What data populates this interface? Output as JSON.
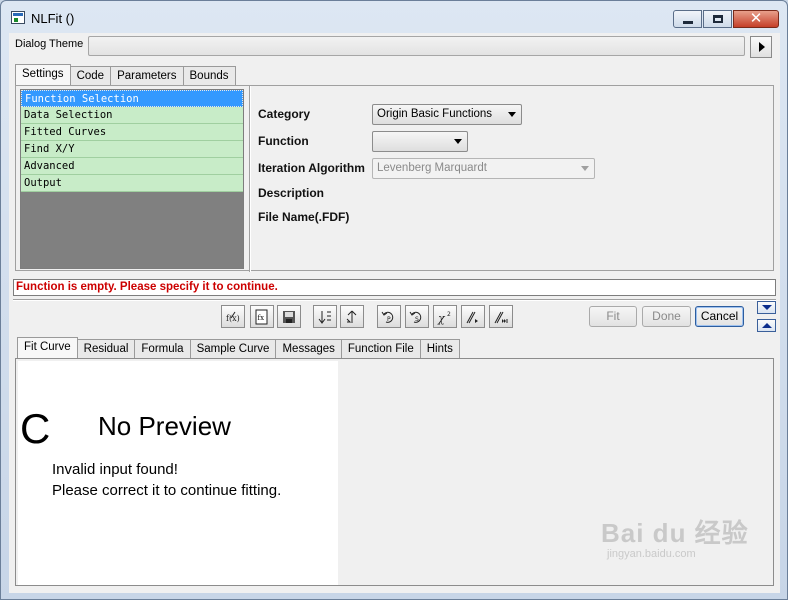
{
  "window": {
    "title": "NLFit ()"
  },
  "theme": {
    "label": "Dialog Theme",
    "value": ""
  },
  "top_tabs": [
    {
      "label": "Settings",
      "active": true
    },
    {
      "label": "Code",
      "active": false
    },
    {
      "label": "Parameters",
      "active": false
    },
    {
      "label": "Bounds",
      "active": false
    }
  ],
  "tree": [
    "Function Selection",
    "Data Selection",
    "Fitted Curves",
    "Find X/Y",
    "Advanced",
    "Output"
  ],
  "props": {
    "category_label": "Category",
    "category_value": "Origin Basic Functions",
    "function_label": "Function",
    "function_value": "",
    "iteration_label": "Iteration Algorithm",
    "iteration_value": "Levenberg Marquardt",
    "description_label": "Description",
    "filename_label": "File Name(.FDF)"
  },
  "message": "Function is empty. Please specify it to continue.",
  "buttons": {
    "fit": "Fit",
    "done": "Done",
    "cancel": "Cancel"
  },
  "bottom_tabs": [
    {
      "label": "Fit Curve",
      "active": true
    },
    {
      "label": "Residual",
      "active": false
    },
    {
      "label": "Formula",
      "active": false
    },
    {
      "label": "Sample Curve",
      "active": false
    },
    {
      "label": "Messages",
      "active": false
    },
    {
      "label": "Function File",
      "active": false
    },
    {
      "label": "Hints",
      "active": false
    }
  ],
  "preview": {
    "glyph": "C",
    "title": "No Preview",
    "line1": "Invalid input found!",
    "line2": "Please correct it to continue fitting."
  },
  "watermark": {
    "main": "Bai du 经验",
    "sub": "jingyan.baidu.com"
  }
}
